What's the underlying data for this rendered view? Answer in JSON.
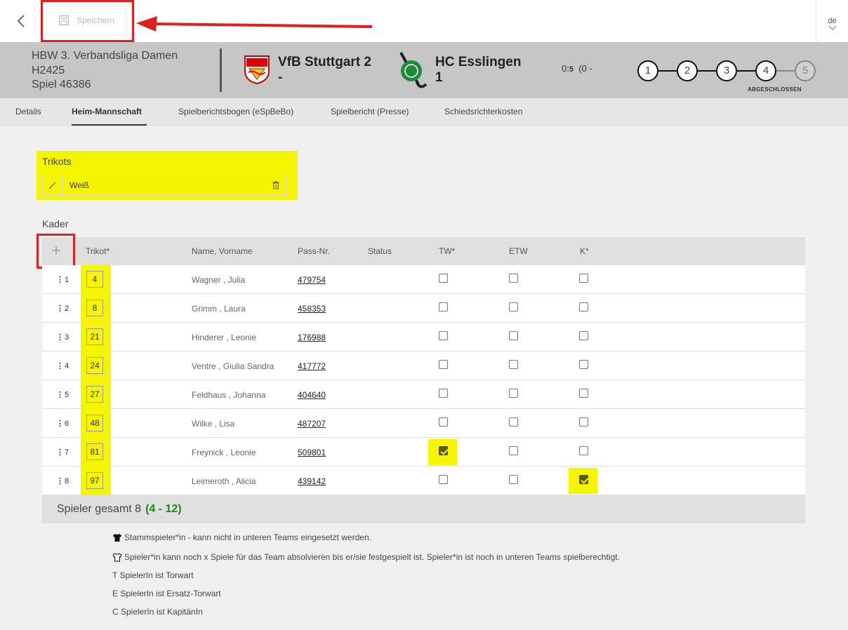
{
  "toolbar": {
    "save_label": "Speichern"
  },
  "language": {
    "code": "de"
  },
  "match": {
    "league_line1": "HBW 3. Verbandsliga Damen",
    "league_line2": "H2425",
    "league_line3": "Spiel 46386",
    "home_team_line1": "VfB Stuttgart 2",
    "home_team_line2": "-",
    "away_team_line1": "HC Esslingen",
    "away_team_line2": "1",
    "score_prefix": "0:",
    "score_value": "5",
    "score_suffix": "(0 -",
    "steps": [
      "1",
      "2",
      "3",
      "4",
      "5"
    ],
    "active_step": 4,
    "step_label": "ABGESCHLOSSEN"
  },
  "tabs": [
    "Details",
    "Heim-Mannschaft",
    "Spielberichtsbogen (eSpBeBo)",
    "Spielbericht (Presse)",
    "Schiedsrichterkosten"
  ],
  "active_tab": "Heim-Mannschaft",
  "trikots": {
    "title": "Trikots",
    "value": "Weiß"
  },
  "kader": {
    "title": "Kader",
    "headers": {
      "trikot": "Trikot*",
      "name": "Name, Vorname",
      "pass": "Pass-Nr.",
      "status": "Status",
      "tw": "TW*",
      "etw": "ETW",
      "k": "K*"
    },
    "rows": [
      {
        "idx": "1",
        "trikot": "4",
        "name": "Wagner , Julia",
        "pass": "479754",
        "tw": false,
        "etw": false,
        "k": false
      },
      {
        "idx": "2",
        "trikot": "8",
        "name": "Grimm , Laura",
        "pass": "458353",
        "tw": false,
        "etw": false,
        "k": false
      },
      {
        "idx": "3",
        "trikot": "21",
        "name": "Hinderer , Leonie",
        "pass": "176988",
        "tw": false,
        "etw": false,
        "k": false
      },
      {
        "idx": "4",
        "trikot": "24",
        "name": "Ventre , Giulia Sandra",
        "pass": "417772",
        "tw": false,
        "etw": false,
        "k": false
      },
      {
        "idx": "5",
        "trikot": "27",
        "name": "Feldhaus , Johanna",
        "pass": "404640",
        "tw": false,
        "etw": false,
        "k": false
      },
      {
        "idx": "6",
        "trikot": "48",
        "name": "Wilke , Lisa",
        "pass": "487207",
        "tw": false,
        "etw": false,
        "k": false
      },
      {
        "idx": "7",
        "trikot": "81",
        "name": "Freynick , Leonie",
        "pass": "509801",
        "tw": true,
        "etw": false,
        "k": false
      },
      {
        "idx": "8",
        "trikot": "97",
        "name": "Leimeroth , Alicia",
        "pass": "439142",
        "tw": false,
        "etw": false,
        "k": true
      }
    ],
    "total_label": "Spieler gesamt 8",
    "total_range": "(4 - 12)"
  },
  "legend": [
    {
      "icon": "shirt-filled-icon",
      "text": "Stammspieler*in - kann nicht in unteren Teams eingesetzt werden."
    },
    {
      "icon": "shirt-outline-icon",
      "text": "Spieler*in kann noch x Spiele für das Team absolvieren bis er/sie festgespielt ist. Spieler*in ist noch in unteren Teams spielberechtigt."
    },
    {
      "icon": "",
      "text": "T SpielerIn ist Torwart"
    },
    {
      "icon": "",
      "text": "E SpielerIn ist Ersatz-Torwart"
    },
    {
      "icon": "",
      "text": "C SpielerIn ist KapitänIn"
    }
  ],
  "colors": {
    "highlight": "#f5f500",
    "annotation": "#e02020",
    "range": "#1a8a1a"
  }
}
